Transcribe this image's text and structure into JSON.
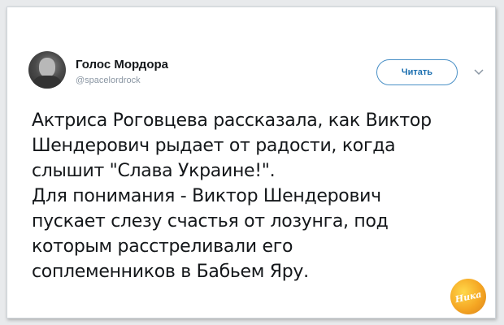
{
  "tweet": {
    "author": {
      "display_name": "Голос Мордора",
      "handle": "@spacelordrock"
    },
    "follow_label": "Читать",
    "menu_icon": "chevron-down-icon",
    "text_lines": [
      "Актриса Роговцева рассказала, как Виктор",
      "Шендерович рыдает от радости, когда",
      "слышит \"Слава Украине!\".",
      "Для понимания - Виктор Шендерович",
      "пускает слезу счастья от лозунга, под",
      "которым расстреливали его",
      "соплеменников в Бабьем Яру."
    ]
  },
  "watermark": {
    "text": "Ника"
  },
  "colors": {
    "accent": "#1b6fb0",
    "text": "#14171a",
    "muted": "#8a96a3"
  }
}
